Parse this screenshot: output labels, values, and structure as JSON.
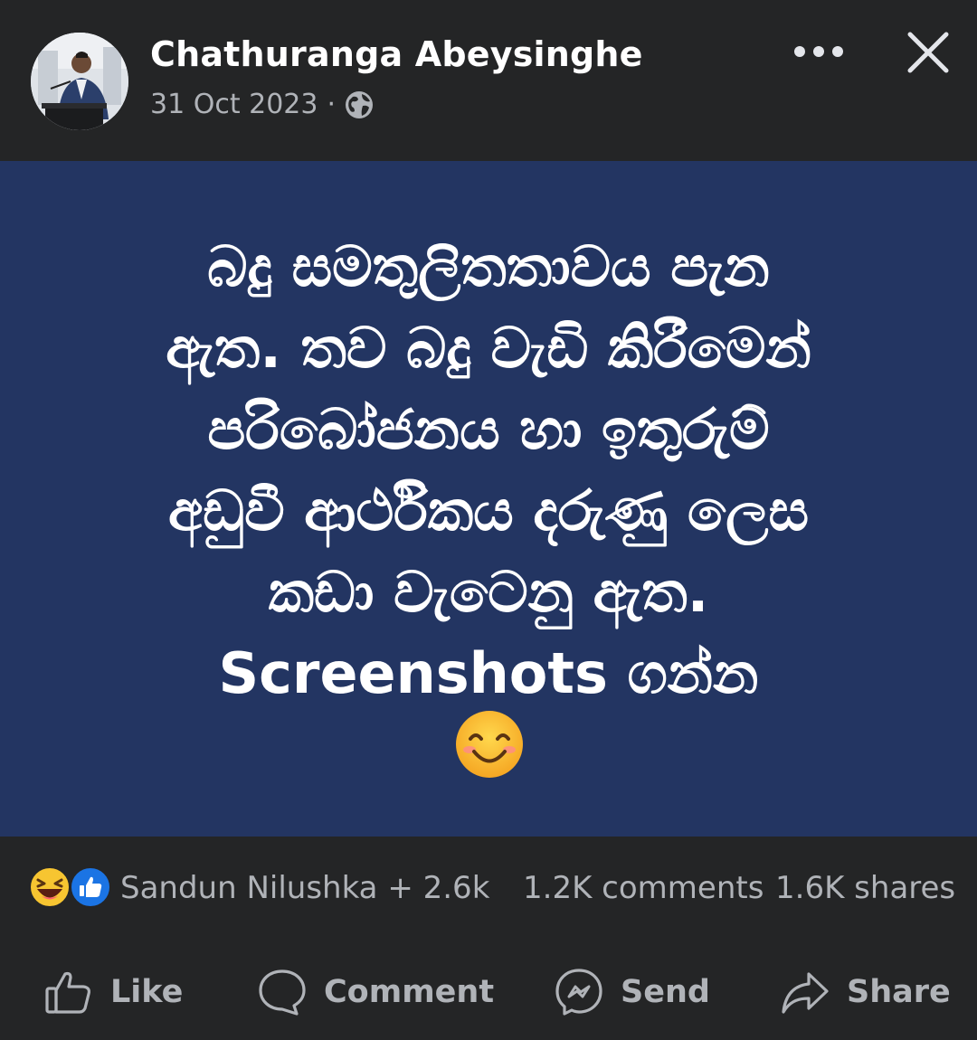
{
  "author": {
    "name": "Chathuranga Abeysinghe",
    "date": "31 Oct 2023",
    "separator": "·",
    "privacy_icon": "globe-icon"
  },
  "header_actions": {
    "more_icon": "more-dots-icon",
    "close_icon": "close-icon"
  },
  "post": {
    "background_color": "#233562",
    "lines": [
      "බදු සමතුලිතතාවය පැන",
      "ඇත. තව බදු වැඩි කිරීමෙන්",
      "පරිබෝජනය හා ඉතුරුම්",
      "අඩුවී ආර්ථිකය දරුණු ලෙස",
      "කඩා වැටෙනු ඇත.",
      "Screenshots ගන්න"
    ],
    "emoji": "smiling-face-emoji"
  },
  "stats": {
    "reaction_icons": [
      "laughing-emoji",
      "like-reaction-icon"
    ],
    "reacted_by": "Sandun Nilushka + 2.6k",
    "comments": "1.2K comments",
    "shares": "1.6K shares"
  },
  "actions": {
    "like": "Like",
    "comment": "Comment",
    "send": "Send",
    "share": "Share"
  }
}
